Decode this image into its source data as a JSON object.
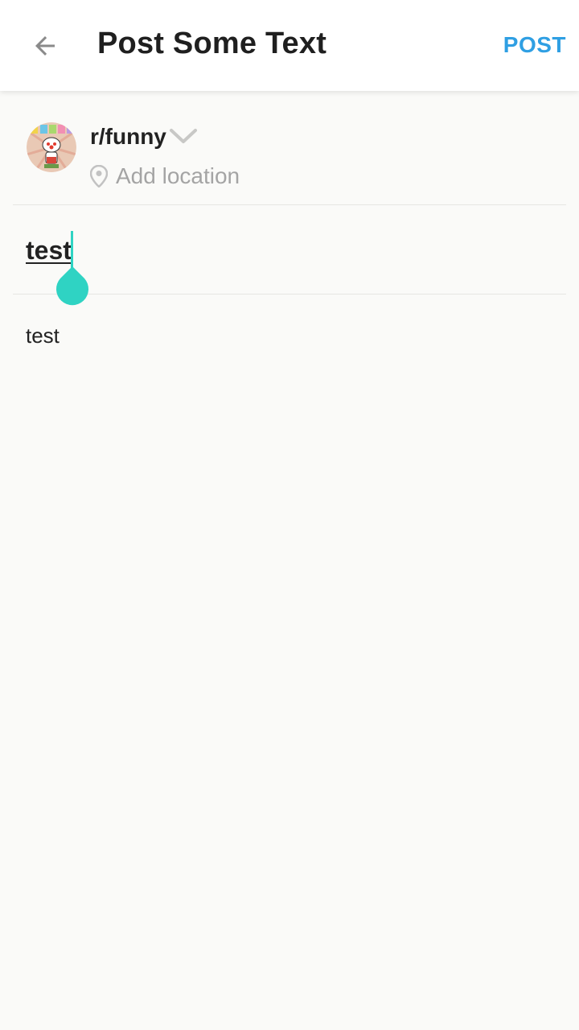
{
  "appbar": {
    "title": "Post Some Text",
    "post_label": "POST",
    "back_icon": "arrow-left-icon"
  },
  "subreddit": {
    "name": "r/funny",
    "dropdown_icon": "chevron-down-icon",
    "location_icon": "location-pin-icon",
    "location_placeholder": "Add location"
  },
  "post": {
    "title": "test",
    "body": "test"
  },
  "colors": {
    "accent": "#2f9fe3",
    "cursor": "#2fd3c3",
    "text": "#222222",
    "muted": "#a4a4a4",
    "background": "#fafaf8"
  }
}
